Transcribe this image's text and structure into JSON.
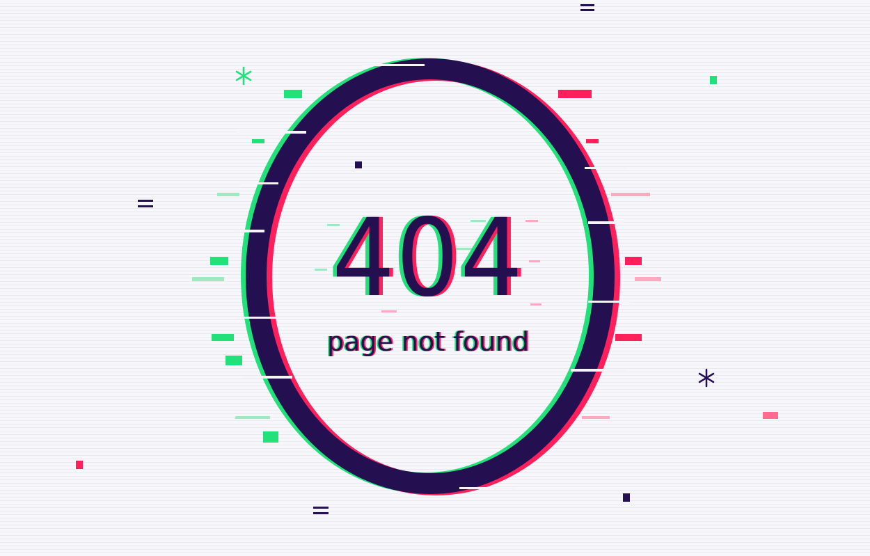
{
  "error": {
    "code": "404",
    "message": "page not found"
  },
  "colors": {
    "background": "#f4f4f9",
    "ring": "#241050",
    "glitch_green": "#22e07a",
    "glitch_red": "#ff1f5a"
  },
  "icons": [
    "asterisk-icon",
    "equals-icon"
  ]
}
